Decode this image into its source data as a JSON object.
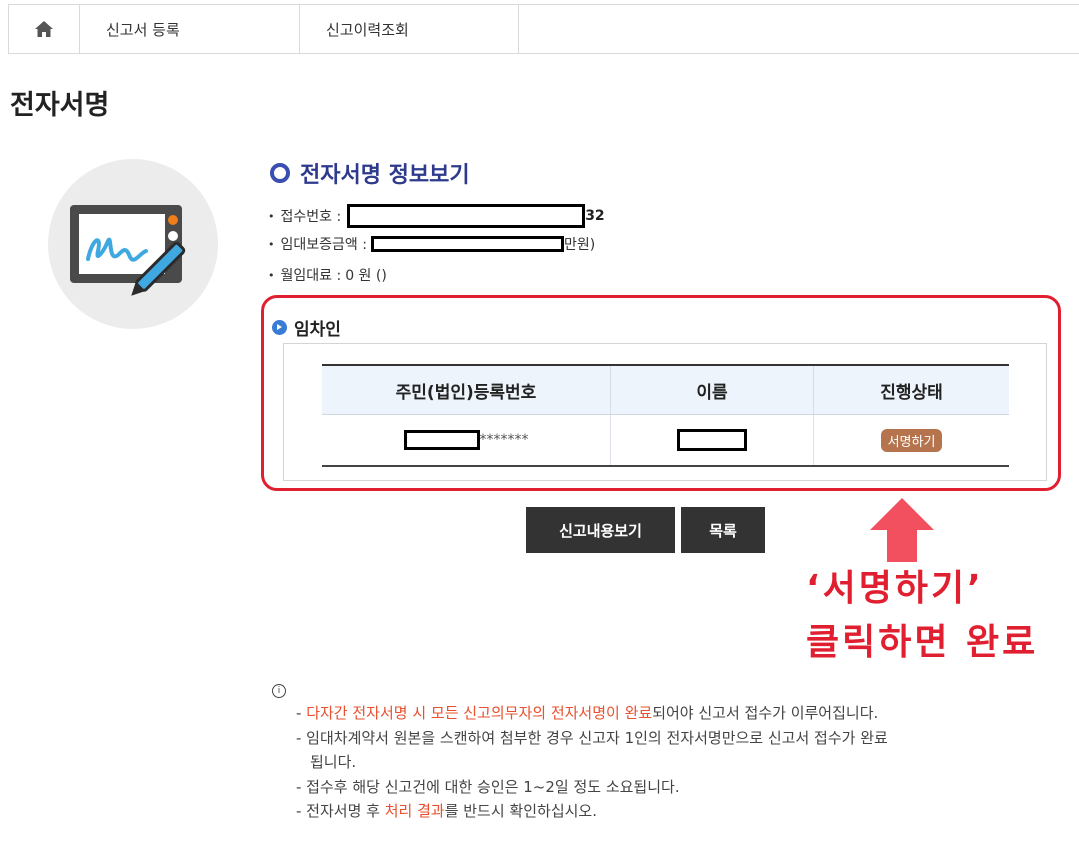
{
  "nav": {
    "home_icon": "home-icon",
    "tab_register": "신고서 등록",
    "tab_history": "신고이력조회"
  },
  "page_title": "전자서명",
  "section_title": "전자서명 정보보기",
  "info": {
    "receipt_label": "접수번호 :",
    "receipt_suffix": "32",
    "deposit_label": "임대보증금액 :",
    "deposit_suffix": "만원)",
    "rent_label": "월임대료 :",
    "rent_value": "0 원 ()"
  },
  "tenant": {
    "title": "임차인",
    "headers": [
      "주민(법인)등록번호",
      "이름",
      "진행상태"
    ],
    "rows": [
      {
        "reg_no_masked": "*******",
        "sign_button": "서명하기"
      }
    ]
  },
  "buttons": {
    "view_content": "신고내용보기",
    "list": "목록"
  },
  "annotation": {
    "line1": "‘서명하기’",
    "line2": "클릭하면 완료"
  },
  "notice": {
    "icon": "info-icon",
    "lines": {
      "l1_a": "- ",
      "l1_hl": "다자간 전자서명 시 모든 신고의무자의 전자서명이 완료",
      "l1_b": "되어야 신고서 접수가 이루어집니다.",
      "l2": "- 임대차계약서 원본을 스캔하여 첨부한 경우 신고자 1인의 전자서명만으로 신고서 접수가 완료",
      "l2b": "됩니다.",
      "l3": "- 접수후 해당 신고건에 대한 승인은 1~2일 정도 소요됩니다.",
      "l4_a": "- 전자서명 후 ",
      "l4_hl": "처리 결과",
      "l4_b": "를 반드시 확인하십시오."
    }
  },
  "colors": {
    "title_blue": "#2e3a8c",
    "annotation_red": "#e02030",
    "sign_button_brown": "#b5744e",
    "highlight_orange": "#e8502e"
  }
}
